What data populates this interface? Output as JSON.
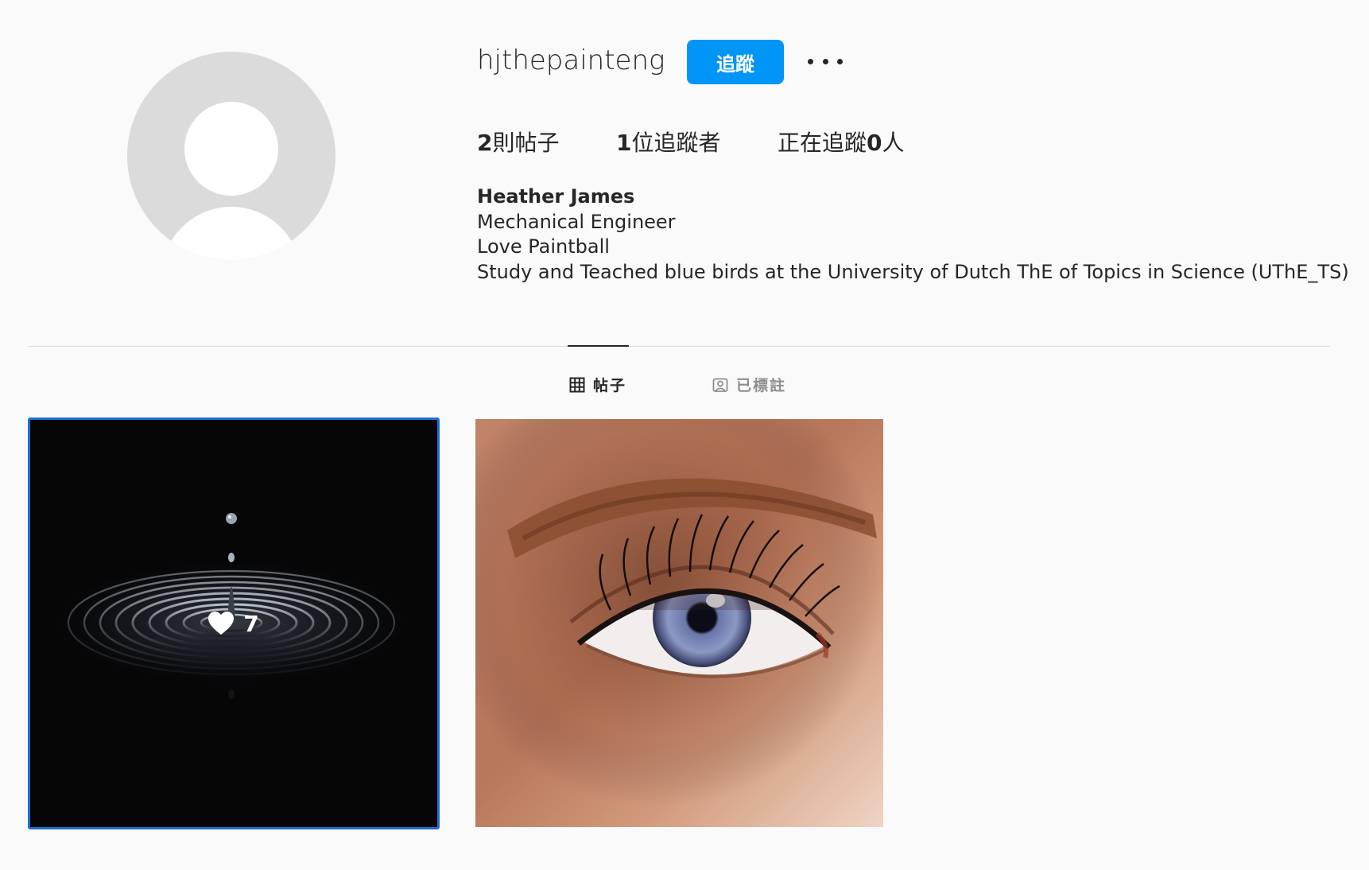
{
  "profile": {
    "username": "hjthepainteng",
    "follow_label": "追蹤",
    "stats": {
      "posts_count": "2",
      "posts_label": "則帖子",
      "followers_count": "1",
      "followers_label": "位追蹤者",
      "following_prefix": "正在追蹤",
      "following_count": "0",
      "following_suffix": "人"
    },
    "bio": {
      "name": "Heather James",
      "lines": [
        "Mechanical Engineer",
        "Love Paintball",
        "Study and Teached blue birds at the University of Dutch ThE of Topics in Science (UThE_TS)"
      ]
    }
  },
  "tabs": {
    "posts": "帖子",
    "tagged": "已標註"
  },
  "posts": [
    {
      "subject": "water droplet ripple",
      "likes": "7"
    },
    {
      "subject": "close-up blue eye"
    }
  ],
  "colors": {
    "accent": "#0095f6",
    "background": "#fafafa",
    "text": "#262626",
    "muted": "#8e8e8e",
    "selection": "#1a6fd6"
  }
}
